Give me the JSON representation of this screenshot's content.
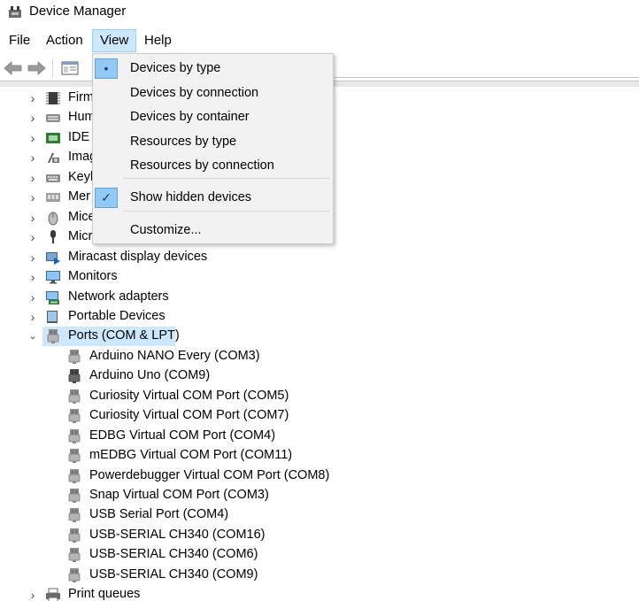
{
  "window": {
    "title": "Device Manager"
  },
  "menubar": {
    "items": [
      "File",
      "Action",
      "View",
      "Help"
    ]
  },
  "view_menu": {
    "items": [
      {
        "label": "Devices by type",
        "mark": "•"
      },
      {
        "label": "Devices by connection",
        "mark": ""
      },
      {
        "label": "Devices by container",
        "mark": ""
      },
      {
        "label": "Resources by type",
        "mark": ""
      },
      {
        "label": "Resources by connection",
        "mark": ""
      },
      {
        "label": "Show hidden devices",
        "mark": "✓"
      },
      {
        "label": "Customize...",
        "mark": ""
      }
    ]
  },
  "tree": {
    "categories_top": [
      {
        "label": "Firm",
        "icon": "firmware-chip-icon"
      },
      {
        "label": "Hum",
        "icon": "human-interface-icon"
      },
      {
        "label": "IDE A",
        "icon": "ide-controller-icon"
      },
      {
        "label": "Imag",
        "icon": "imaging-device-icon"
      },
      {
        "label": "Keyb",
        "icon": "keyboard-icon"
      },
      {
        "label": "Mer",
        "icon": "memory-device-icon"
      },
      {
        "label": "Mice",
        "icon": "mouse-icon"
      },
      {
        "label": "Micr",
        "icon": "microphone-icon"
      },
      {
        "label": "Miracast display devices",
        "icon": "miracast-icon"
      },
      {
        "label": "Monitors",
        "icon": "monitor-icon"
      },
      {
        "label": "Network adapters",
        "icon": "network-adapter-icon"
      },
      {
        "label": "Portable Devices",
        "icon": "portable-device-icon"
      }
    ],
    "ports": {
      "label": "Ports (COM & LPT)",
      "children": [
        "Arduino NANO Every (COM3)",
        "Arduino Uno (COM9)",
        "Curiosity Virtual COM Port (COM5)",
        "Curiosity Virtual COM Port (COM7)",
        "EDBG Virtual COM Port (COM4)",
        "mEDBG Virtual COM Port (COM11)",
        "Powerdebugger Virtual COM Port (COM8)",
        "Snap Virtual COM Port (COM3)",
        "USB Serial Port (COM4)",
        "USB-SERIAL CH340 (COM16)",
        "USB-SERIAL CH340 (COM6)",
        "USB-SERIAL CH340 (COM9)"
      ]
    },
    "after": [
      {
        "label": "Print queues",
        "icon": "printer-icon"
      }
    ]
  }
}
